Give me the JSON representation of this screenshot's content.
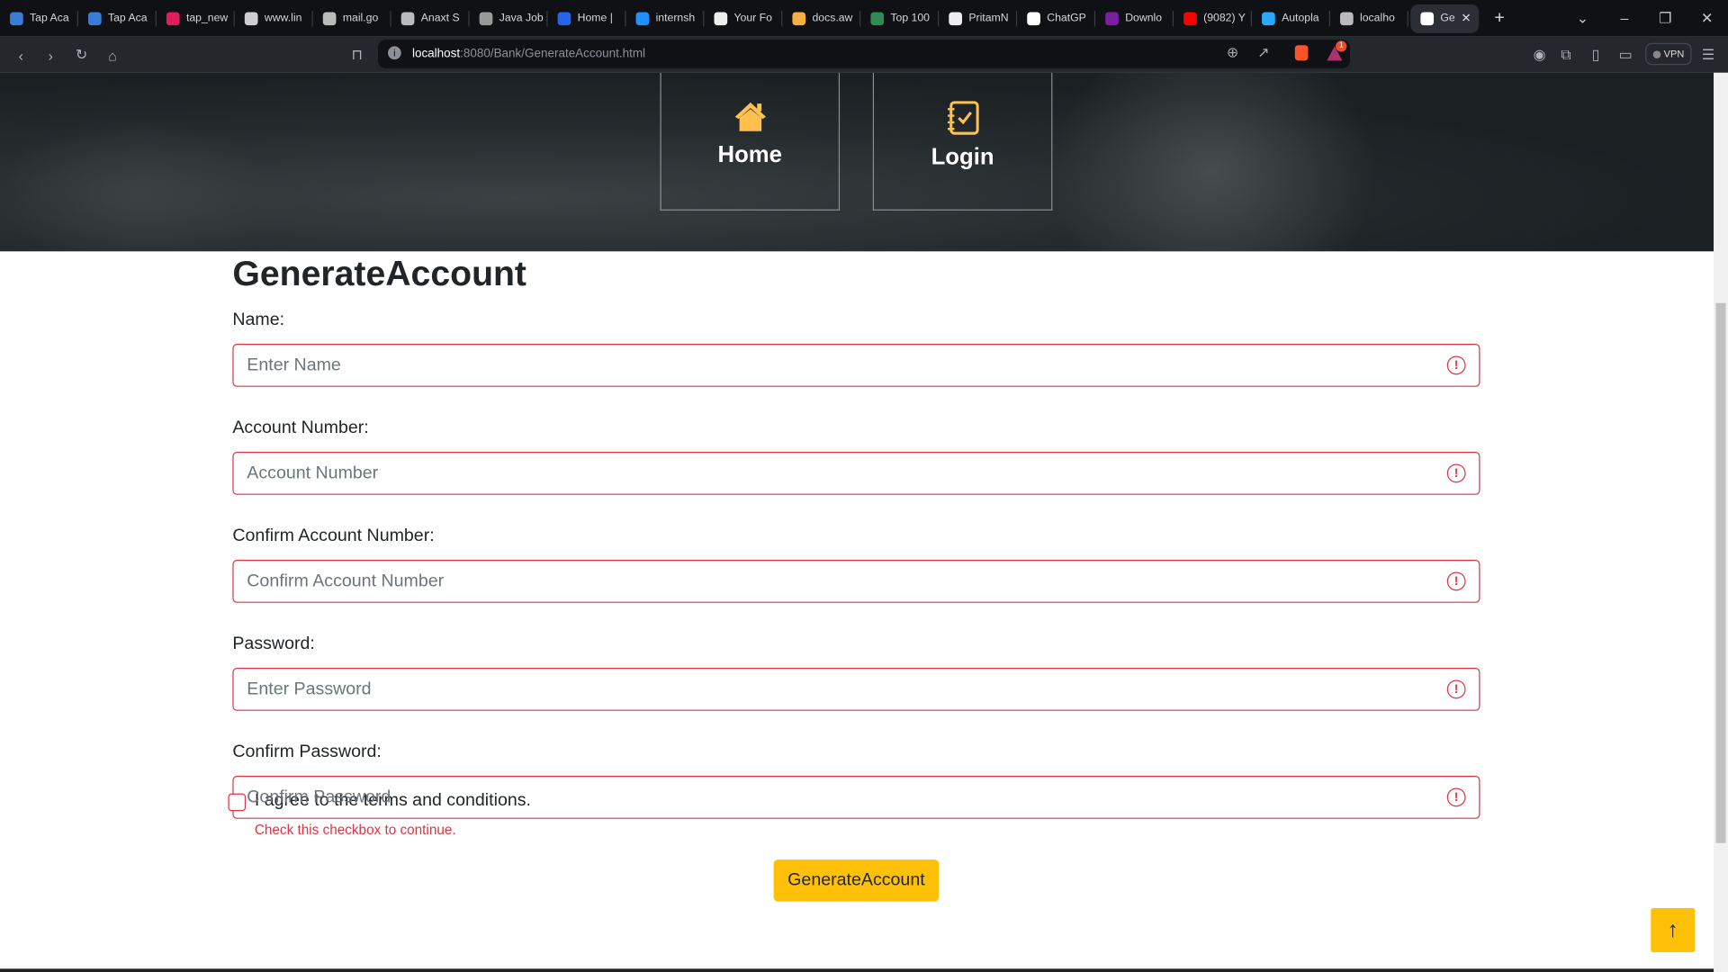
{
  "browser": {
    "tabs": [
      {
        "label": "Tap Aca",
        "color": "#3a7bd5"
      },
      {
        "label": "Tap Aca",
        "color": "#3a7bd5"
      },
      {
        "label": "tap_new",
        "color": "#e01e5a"
      },
      {
        "label": "www.lin",
        "color": "#cfcfcf"
      },
      {
        "label": "mail.go",
        "color": "#bbbbbb"
      },
      {
        "label": "Anaxt S",
        "color": "#bbbbbb"
      },
      {
        "label": "Java Job",
        "color": "#999999"
      },
      {
        "label": "Home |",
        "color": "#2563eb"
      },
      {
        "label": "internsh",
        "color": "#1e90ff"
      },
      {
        "label": "Your Fo",
        "color": "#eeeeee"
      },
      {
        "label": "docs.aw",
        "color": "#f5b041"
      },
      {
        "label": "Top 100",
        "color": "#2e8b57"
      },
      {
        "label": "PritamN",
        "color": "#eeeeee"
      },
      {
        "label": "ChatGP",
        "color": "#ffffff"
      },
      {
        "label": "Downlo",
        "color": "#7b1fa2"
      },
      {
        "label": "(9082) Y",
        "color": "#ff0000"
      },
      {
        "label": "Autopla",
        "color": "#29a9ff"
      },
      {
        "label": "localho",
        "color": "#bbbbbb"
      }
    ],
    "active_tab": {
      "label": "Ge"
    },
    "url_host": "localhost",
    "url_rest": ":8080/Bank/GenerateAccount.html",
    "vpn_label": "VPN",
    "notification_count": "1"
  },
  "nav": {
    "items": [
      {
        "label": "Home",
        "icon": "home-icon"
      },
      {
        "label": "Login",
        "icon": "checklist-icon"
      }
    ]
  },
  "form": {
    "title": "GenerateAccount",
    "fields": [
      {
        "label": "Name:",
        "placeholder": "Enter Name"
      },
      {
        "label": "Account Number:",
        "placeholder": "Account Number"
      },
      {
        "label": "Confirm Account Number:",
        "placeholder": "Confirm Account Number"
      },
      {
        "label": "Password:",
        "placeholder": "Enter Password"
      },
      {
        "label": "Confirm Password:",
        "placeholder": "Confirm Password"
      }
    ],
    "terms_label": "I agree to the terms and conditions.",
    "terms_error": "Check this checkbox to continue.",
    "submit_label": "GenerateAccount"
  },
  "colors": {
    "accent": "#ffc107",
    "error": "#dc3545"
  }
}
